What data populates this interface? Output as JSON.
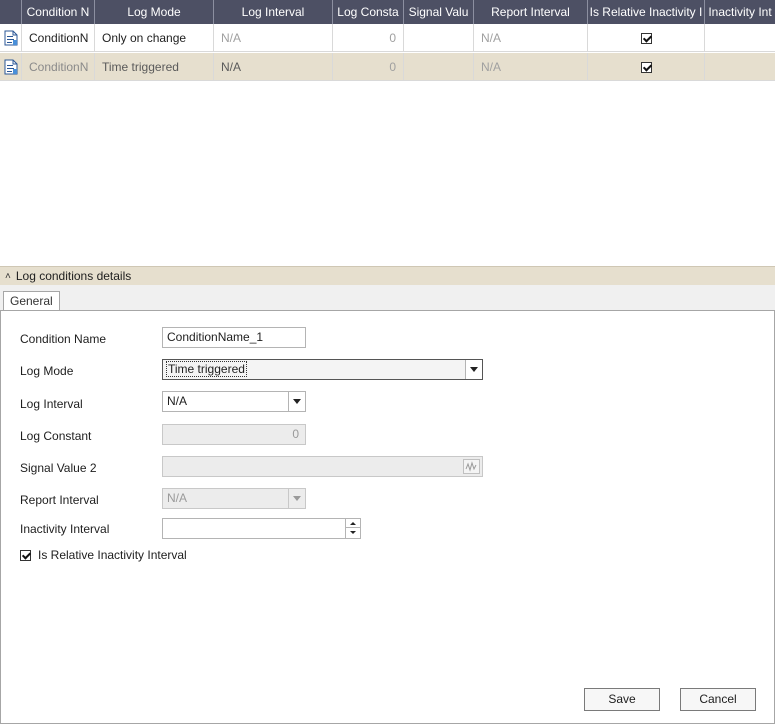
{
  "grid": {
    "columns": [
      "Condition N",
      "Log Mode",
      "Log Interval",
      "Log Consta",
      "Signal Valu",
      "Report Interval",
      "Is Relative Inactivity I",
      "Inactivity Int"
    ],
    "rows": [
      {
        "icon": "document-icon",
        "condition_name": "ConditionN",
        "log_mode": "Only on change",
        "log_interval": "N/A",
        "log_constant": "0",
        "signal_value": "",
        "report_interval": "N/A",
        "is_relative": true,
        "inactivity_interval": ""
      },
      {
        "icon": "document-icon",
        "condition_name": "ConditionN",
        "log_mode": "Time triggered",
        "log_interval": "N/A",
        "log_constant": "0",
        "signal_value": "",
        "report_interval": "N/A",
        "is_relative": true,
        "inactivity_interval": ""
      }
    ],
    "header_color": "#4d5064",
    "selected_row_color": "#e6dfce"
  },
  "details": {
    "title": "Log conditions details",
    "tab": "General",
    "fields": {
      "condition_name": {
        "label": "Condition Name",
        "value": "ConditionName_1"
      },
      "log_mode": {
        "label": "Log Mode",
        "value": "Time triggered"
      },
      "log_interval": {
        "label": "Log Interval",
        "value": "N/A"
      },
      "log_constant": {
        "label": "Log Constant",
        "value": "0"
      },
      "signal_value_2": {
        "label": "Signal Value 2",
        "value": ""
      },
      "report_interval": {
        "label": "Report Interval",
        "value": "N/A"
      },
      "inactivity_interval": {
        "label": "Inactivity Interval",
        "value": ""
      }
    },
    "is_relative_inactivity": {
      "label": "Is Relative Inactivity Interval",
      "checked": true
    }
  },
  "buttons": {
    "save": "Save",
    "cancel": "Cancel"
  }
}
